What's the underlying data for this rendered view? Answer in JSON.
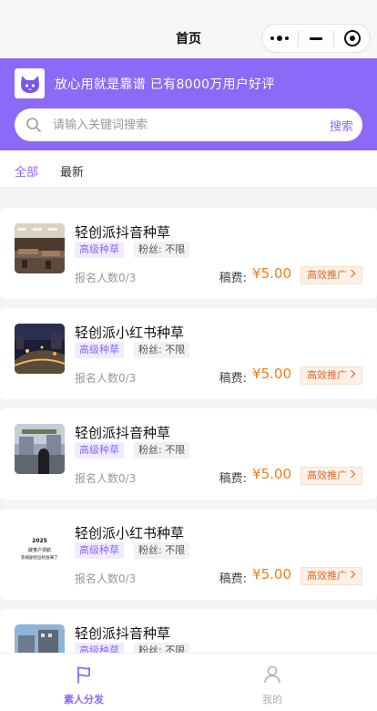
{
  "navbar": {
    "title": "首页",
    "capsule_icons": [
      "more-dots-icon",
      "minimize-icon",
      "close-target-icon"
    ]
  },
  "hero": {
    "logo_icon": "cat-icon",
    "slogan": "放心用就是靠谱 已有8000万用户好评",
    "search": {
      "placeholder": "请输入关键词搜索",
      "value": "",
      "button_label": "搜索"
    }
  },
  "tabs": [
    {
      "label": "全部",
      "active": true
    },
    {
      "label": "最新",
      "active": false
    }
  ],
  "items": [
    {
      "title": "轻创派抖音种草",
      "level_tag": "高级种草",
      "fans_tag": "粉丝: 不限",
      "applicants": "报名人数0/3",
      "fee_label": "稿费:",
      "fee_value": "¥5.00",
      "promote_label": "高效推广"
    },
    {
      "title": "轻创派小红书种草",
      "level_tag": "高级种草",
      "fans_tag": "粉丝: 不限",
      "applicants": "报名人数0/3",
      "fee_label": "稿费:",
      "fee_value": "¥5.00",
      "promote_label": "高效推广"
    },
    {
      "title": "轻创派抖音种草",
      "level_tag": "高级种草",
      "fans_tag": "粉丝: 不限",
      "applicants": "报名人数0/3",
      "fee_label": "稿费:",
      "fee_value": "¥5.00",
      "promote_label": "高效推广"
    },
    {
      "title": "轻创派小红书种草",
      "level_tag": "高级种草",
      "fans_tag": "粉丝: 不限",
      "applicants": "报名人数0/3",
      "fee_label": "稿费:",
      "fee_value": "¥5.00",
      "promote_label": "高效推广",
      "thumb_text": [
        "2025",
        "破茧户领航",
        "影视剧创业机会来了"
      ]
    },
    {
      "title": "轻创派抖音种草",
      "level_tag": "高级种草",
      "fans_tag": "粉丝: 不限",
      "applicants": "",
      "fee_label": "",
      "fee_value": "",
      "promote_label": ""
    }
  ],
  "tabbar": {
    "home_label": "素人分发",
    "home_icon": "flag-icon",
    "mine_label": "我的",
    "mine_icon": "user-icon"
  },
  "colors": {
    "brand": "#8c69f6",
    "price": "#f27d1e",
    "promote": "#e06a2b"
  }
}
